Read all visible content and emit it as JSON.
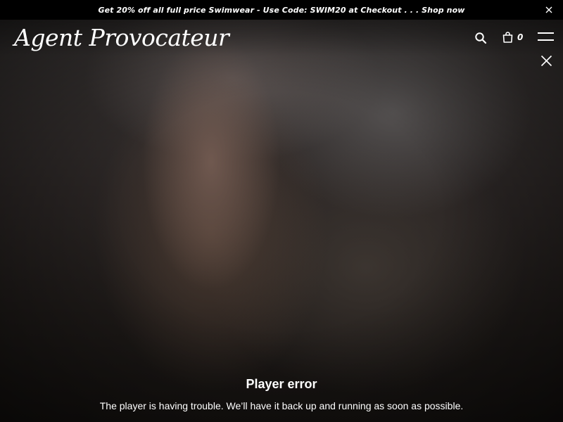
{
  "promo": {
    "text": "Get 20% off all full price Swimwear - Use Code: SWIM20 at Checkout . . . Shop now",
    "close_icon": "close-icon"
  },
  "header": {
    "logo": "Agent Provocateur",
    "search_icon": "search-icon",
    "bag_icon": "shopping-bag-icon",
    "bag_count": "0",
    "menu_icon": "hamburger-menu-icon"
  },
  "player": {
    "close_icon": "close-icon",
    "error_title": "Player error",
    "error_message": "The player is having trouble. We’ll have it back up and running as soon as possible."
  },
  "colors": {
    "banner_bg": "#000000",
    "text": "#ffffff"
  }
}
